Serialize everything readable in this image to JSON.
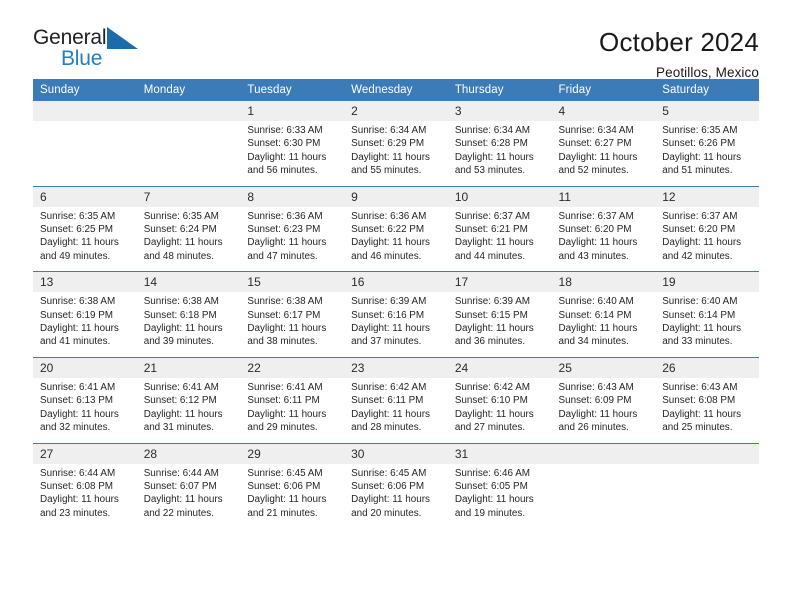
{
  "brand": {
    "name_part1": "General",
    "name_part2": "Blue",
    "triangle_icon": "triangle-icon"
  },
  "header": {
    "title": "October 2024",
    "subtitle": "Peotillos, Mexico"
  },
  "colors": {
    "header_blue": "#3b7cb8",
    "brand_blue": "#1f7ec4",
    "daynum_band": "#efefef"
  },
  "calendar": {
    "weekday_headers": [
      "Sunday",
      "Monday",
      "Tuesday",
      "Wednesday",
      "Thursday",
      "Friday",
      "Saturday"
    ],
    "weeks": [
      [
        {
          "day": "",
          "sunrise": "",
          "sunset": "",
          "daylight_l1": "",
          "daylight_l2": ""
        },
        {
          "day": "",
          "sunrise": "",
          "sunset": "",
          "daylight_l1": "",
          "daylight_l2": ""
        },
        {
          "day": "1",
          "sunrise": "Sunrise: 6:33 AM",
          "sunset": "Sunset: 6:30 PM",
          "daylight_l1": "Daylight: 11 hours",
          "daylight_l2": "and 56 minutes."
        },
        {
          "day": "2",
          "sunrise": "Sunrise: 6:34 AM",
          "sunset": "Sunset: 6:29 PM",
          "daylight_l1": "Daylight: 11 hours",
          "daylight_l2": "and 55 minutes."
        },
        {
          "day": "3",
          "sunrise": "Sunrise: 6:34 AM",
          "sunset": "Sunset: 6:28 PM",
          "daylight_l1": "Daylight: 11 hours",
          "daylight_l2": "and 53 minutes."
        },
        {
          "day": "4",
          "sunrise": "Sunrise: 6:34 AM",
          "sunset": "Sunset: 6:27 PM",
          "daylight_l1": "Daylight: 11 hours",
          "daylight_l2": "and 52 minutes."
        },
        {
          "day": "5",
          "sunrise": "Sunrise: 6:35 AM",
          "sunset": "Sunset: 6:26 PM",
          "daylight_l1": "Daylight: 11 hours",
          "daylight_l2": "and 51 minutes."
        }
      ],
      [
        {
          "day": "6",
          "sunrise": "Sunrise: 6:35 AM",
          "sunset": "Sunset: 6:25 PM",
          "daylight_l1": "Daylight: 11 hours",
          "daylight_l2": "and 49 minutes."
        },
        {
          "day": "7",
          "sunrise": "Sunrise: 6:35 AM",
          "sunset": "Sunset: 6:24 PM",
          "daylight_l1": "Daylight: 11 hours",
          "daylight_l2": "and 48 minutes."
        },
        {
          "day": "8",
          "sunrise": "Sunrise: 6:36 AM",
          "sunset": "Sunset: 6:23 PM",
          "daylight_l1": "Daylight: 11 hours",
          "daylight_l2": "and 47 minutes."
        },
        {
          "day": "9",
          "sunrise": "Sunrise: 6:36 AM",
          "sunset": "Sunset: 6:22 PM",
          "daylight_l1": "Daylight: 11 hours",
          "daylight_l2": "and 46 minutes."
        },
        {
          "day": "10",
          "sunrise": "Sunrise: 6:37 AM",
          "sunset": "Sunset: 6:21 PM",
          "daylight_l1": "Daylight: 11 hours",
          "daylight_l2": "and 44 minutes."
        },
        {
          "day": "11",
          "sunrise": "Sunrise: 6:37 AM",
          "sunset": "Sunset: 6:20 PM",
          "daylight_l1": "Daylight: 11 hours",
          "daylight_l2": "and 43 minutes."
        },
        {
          "day": "12",
          "sunrise": "Sunrise: 6:37 AM",
          "sunset": "Sunset: 6:20 PM",
          "daylight_l1": "Daylight: 11 hours",
          "daylight_l2": "and 42 minutes."
        }
      ],
      [
        {
          "day": "13",
          "sunrise": "Sunrise: 6:38 AM",
          "sunset": "Sunset: 6:19 PM",
          "daylight_l1": "Daylight: 11 hours",
          "daylight_l2": "and 41 minutes."
        },
        {
          "day": "14",
          "sunrise": "Sunrise: 6:38 AM",
          "sunset": "Sunset: 6:18 PM",
          "daylight_l1": "Daylight: 11 hours",
          "daylight_l2": "and 39 minutes."
        },
        {
          "day": "15",
          "sunrise": "Sunrise: 6:38 AM",
          "sunset": "Sunset: 6:17 PM",
          "daylight_l1": "Daylight: 11 hours",
          "daylight_l2": "and 38 minutes."
        },
        {
          "day": "16",
          "sunrise": "Sunrise: 6:39 AM",
          "sunset": "Sunset: 6:16 PM",
          "daylight_l1": "Daylight: 11 hours",
          "daylight_l2": "and 37 minutes."
        },
        {
          "day": "17",
          "sunrise": "Sunrise: 6:39 AM",
          "sunset": "Sunset: 6:15 PM",
          "daylight_l1": "Daylight: 11 hours",
          "daylight_l2": "and 36 minutes."
        },
        {
          "day": "18",
          "sunrise": "Sunrise: 6:40 AM",
          "sunset": "Sunset: 6:14 PM",
          "daylight_l1": "Daylight: 11 hours",
          "daylight_l2": "and 34 minutes."
        },
        {
          "day": "19",
          "sunrise": "Sunrise: 6:40 AM",
          "sunset": "Sunset: 6:14 PM",
          "daylight_l1": "Daylight: 11 hours",
          "daylight_l2": "and 33 minutes."
        }
      ],
      [
        {
          "day": "20",
          "sunrise": "Sunrise: 6:41 AM",
          "sunset": "Sunset: 6:13 PM",
          "daylight_l1": "Daylight: 11 hours",
          "daylight_l2": "and 32 minutes."
        },
        {
          "day": "21",
          "sunrise": "Sunrise: 6:41 AM",
          "sunset": "Sunset: 6:12 PM",
          "daylight_l1": "Daylight: 11 hours",
          "daylight_l2": "and 31 minutes."
        },
        {
          "day": "22",
          "sunrise": "Sunrise: 6:41 AM",
          "sunset": "Sunset: 6:11 PM",
          "daylight_l1": "Daylight: 11 hours",
          "daylight_l2": "and 29 minutes."
        },
        {
          "day": "23",
          "sunrise": "Sunrise: 6:42 AM",
          "sunset": "Sunset: 6:11 PM",
          "daylight_l1": "Daylight: 11 hours",
          "daylight_l2": "and 28 minutes."
        },
        {
          "day": "24",
          "sunrise": "Sunrise: 6:42 AM",
          "sunset": "Sunset: 6:10 PM",
          "daylight_l1": "Daylight: 11 hours",
          "daylight_l2": "and 27 minutes."
        },
        {
          "day": "25",
          "sunrise": "Sunrise: 6:43 AM",
          "sunset": "Sunset: 6:09 PM",
          "daylight_l1": "Daylight: 11 hours",
          "daylight_l2": "and 26 minutes."
        },
        {
          "day": "26",
          "sunrise": "Sunrise: 6:43 AM",
          "sunset": "Sunset: 6:08 PM",
          "daylight_l1": "Daylight: 11 hours",
          "daylight_l2": "and 25 minutes."
        }
      ],
      [
        {
          "day": "27",
          "sunrise": "Sunrise: 6:44 AM",
          "sunset": "Sunset: 6:08 PM",
          "daylight_l1": "Daylight: 11 hours",
          "daylight_l2": "and 23 minutes."
        },
        {
          "day": "28",
          "sunrise": "Sunrise: 6:44 AM",
          "sunset": "Sunset: 6:07 PM",
          "daylight_l1": "Daylight: 11 hours",
          "daylight_l2": "and 22 minutes."
        },
        {
          "day": "29",
          "sunrise": "Sunrise: 6:45 AM",
          "sunset": "Sunset: 6:06 PM",
          "daylight_l1": "Daylight: 11 hours",
          "daylight_l2": "and 21 minutes."
        },
        {
          "day": "30",
          "sunrise": "Sunrise: 6:45 AM",
          "sunset": "Sunset: 6:06 PM",
          "daylight_l1": "Daylight: 11 hours",
          "daylight_l2": "and 20 minutes."
        },
        {
          "day": "31",
          "sunrise": "Sunrise: 6:46 AM",
          "sunset": "Sunset: 6:05 PM",
          "daylight_l1": "Daylight: 11 hours",
          "daylight_l2": "and 19 minutes."
        },
        {
          "day": "",
          "sunrise": "",
          "sunset": "",
          "daylight_l1": "",
          "daylight_l2": ""
        },
        {
          "day": "",
          "sunrise": "",
          "sunset": "",
          "daylight_l1": "",
          "daylight_l2": ""
        }
      ]
    ]
  }
}
